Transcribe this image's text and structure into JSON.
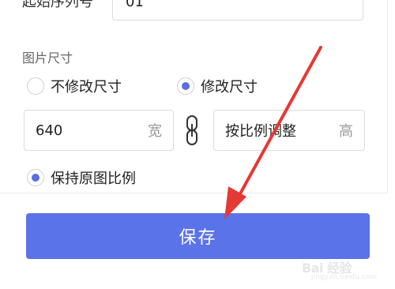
{
  "form": {
    "start_serial_label": "起始序列号",
    "start_serial_value": "01",
    "image_size_label": "图片尺寸",
    "radio_no_change": "不修改尺寸",
    "radio_change": "修改尺寸",
    "radio_keep_ratio": "保持原图比例",
    "width_value": "640",
    "width_suffix": "宽",
    "height_value": "按比例调整",
    "height_suffix": "高",
    "selected_size_mode": "修改尺寸",
    "keep_ratio_checked": true
  },
  "actions": {
    "save_label": "保存"
  },
  "colors": {
    "accent": "#5b73e8",
    "annotation_arrow": "#e53935"
  },
  "watermark": {
    "text": "Bai 经验",
    "sub": "jingyan.baidu.com"
  }
}
